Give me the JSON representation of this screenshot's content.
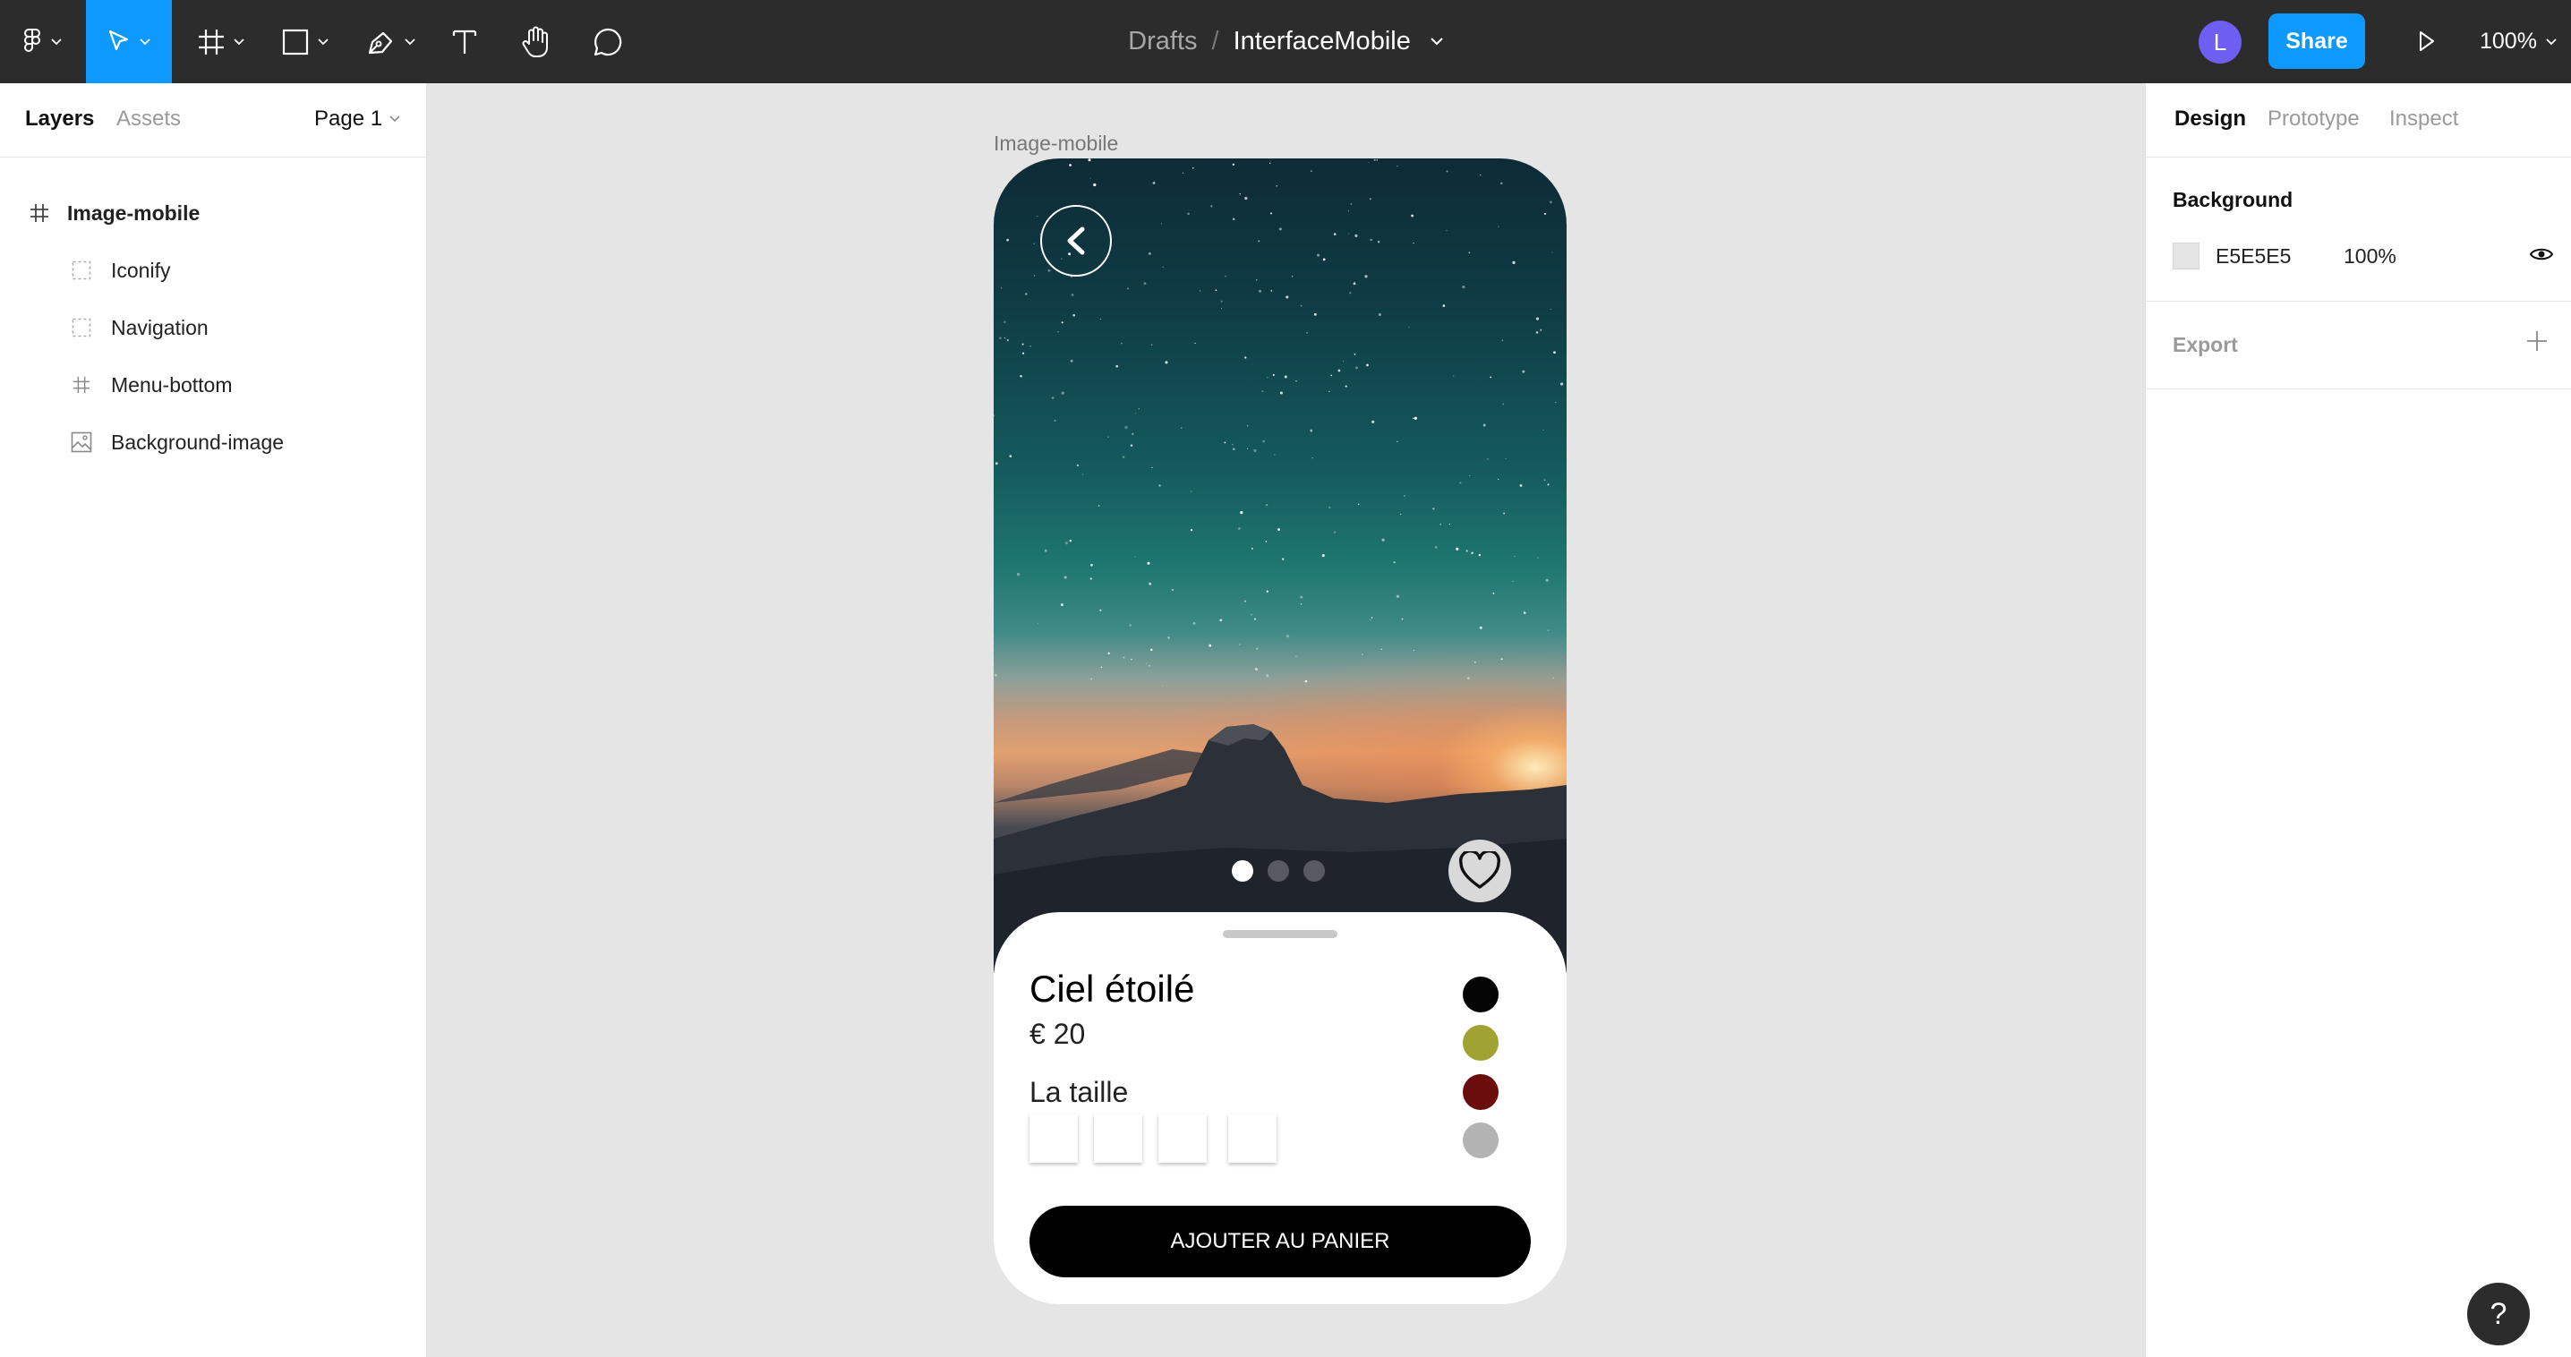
{
  "toolbar": {
    "breadcrumb_parent": "Drafts",
    "breadcrumb_sep": "/",
    "file_name": "InterfaceMobile",
    "avatar_initial": "L",
    "share_label": "Share",
    "zoom": "100%",
    "tools": [
      "figma-menu-icon",
      "move-tool-icon",
      "frame-tool-icon",
      "shape-tool-icon",
      "pen-tool-icon",
      "text-tool-icon",
      "hand-tool-icon",
      "comment-tool-icon"
    ],
    "active_tool": "move-tool-icon"
  },
  "left_panel": {
    "tabs": [
      "Layers",
      "Assets"
    ],
    "active_tab": "Layers",
    "page": "Page 1",
    "layers": [
      {
        "name": "Image-mobile",
        "icon": "frame-icon",
        "level": 0
      },
      {
        "name": "Iconify",
        "icon": "group-dashed-icon",
        "level": 1
      },
      {
        "name": "Navigation",
        "icon": "group-dashed-icon",
        "level": 1
      },
      {
        "name": "Menu-bottom",
        "icon": "frame-icon",
        "level": 1
      },
      {
        "name": "Background-image",
        "icon": "image-icon",
        "level": 1
      }
    ]
  },
  "canvas": {
    "frame_label": "Image-mobile",
    "background": "#e5e5e5",
    "product": {
      "name": "Ciel étoilé",
      "price": "€ 20",
      "size_label": "La taille",
      "size_options": 4,
      "colors": [
        "#050505",
        "#a0a231",
        "#6b0d0d",
        "#b3b3b3"
      ],
      "cta": "AJOUTER AU PANIER"
    },
    "carousel": {
      "pages": 3,
      "current": 1
    }
  },
  "right_panel": {
    "tabs": [
      "Design",
      "Prototype",
      "Inspect"
    ],
    "active_tab": "Design",
    "background_title": "Background",
    "background_hex": "E5E5E5",
    "background_opacity": "100%",
    "export_title": "Export"
  },
  "help_label": "?",
  "colors": {
    "toolbar": "#2c2c2c",
    "accent": "#0d99ff",
    "avatar": "#6e5ff2"
  }
}
